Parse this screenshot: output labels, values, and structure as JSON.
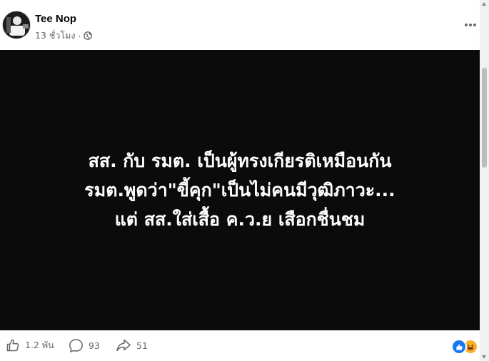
{
  "post": {
    "author": "Tee Nop",
    "time": "13 ชั่วโมง",
    "separator": "·",
    "privacy_icon": "globe-icon",
    "more_icon": "ellipsis-icon"
  },
  "image_text": {
    "line1": "สส. กับ รมต. เป็นผู้ทรงเกียรติเหมือนกัน",
    "line2": "รมต.พูดว่า\"ขี้คุก\"เป็นไม่คนมีวุฒิภาวะ...",
    "line3": "แต่ สส.ใส่เสื้อ ค.ว.ย เสือกชื่นชม"
  },
  "stats": {
    "likes": "1.2 พัน",
    "comments": "93",
    "shares": "51"
  },
  "reactions": [
    "like-icon",
    "haha-icon"
  ],
  "colors": {
    "image_bg": "#0b0b0b",
    "meta_text": "#65676b",
    "like_blue": "#1877f2",
    "haha_yellow": "#f7b125"
  }
}
